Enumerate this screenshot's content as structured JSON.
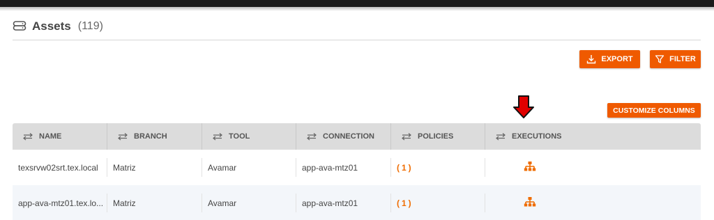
{
  "header": {
    "title": "Assets",
    "count": "(119)",
    "icon": "database-icon"
  },
  "toolbar": {
    "export_label": "EXPORT",
    "filter_label": "FILTER",
    "customize_label": "CUSTOMIZE COLUMNS"
  },
  "colors": {
    "accent": "#ef5a00",
    "arrow": "#e00000",
    "header_bg": "#dcdcdc",
    "alt_row": "#f3f6fa"
  },
  "table": {
    "columns": [
      {
        "label": "NAME"
      },
      {
        "label": "BRANCH"
      },
      {
        "label": "TOOL"
      },
      {
        "label": "CONNECTION"
      },
      {
        "label": "POLICIES"
      },
      {
        "label": "EXECUTIONS"
      }
    ],
    "rows": [
      {
        "name": "texsrvw02srt.tex.local",
        "branch": "Matriz",
        "tool": "Avamar",
        "connection": "app-ava-mtz01",
        "policies": "(1)",
        "executions_icon": "sitemap-icon"
      },
      {
        "name": "app-ava-mtz01.tex.lo...",
        "branch": "Matriz",
        "tool": "Avamar",
        "connection": "app-ava-mtz01",
        "policies": "(1)",
        "executions_icon": "sitemap-icon"
      }
    ]
  }
}
